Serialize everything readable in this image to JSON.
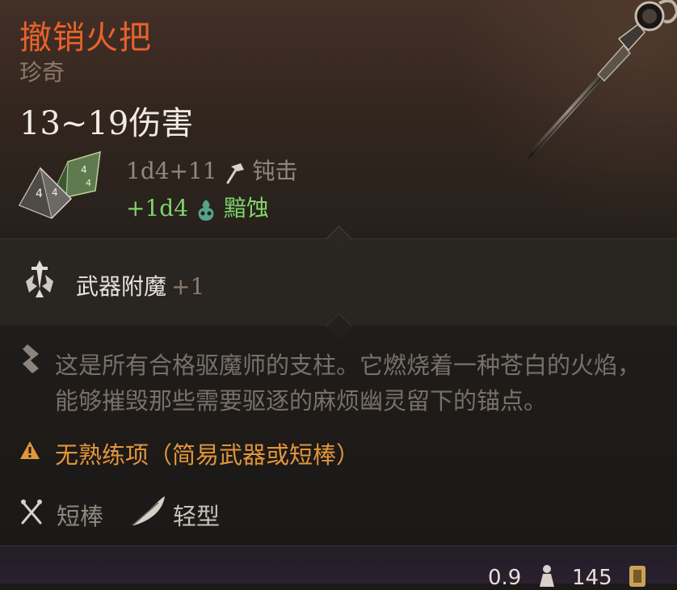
{
  "item": {
    "name": "撤销火把",
    "rarity": "珍奇",
    "damage_range": "13~19伤害",
    "damage_lines": [
      {
        "dice": "1d4+11",
        "type": "钝击",
        "icon": "hammer-icon",
        "color": "#8f8880"
      },
      {
        "dice": "+1d4",
        "type": "黯蚀",
        "icon": "necrotic-skull-icon",
        "color": "#7fd46a"
      }
    ],
    "enchantment": {
      "label": "武器附魔",
      "bonus": "+1",
      "icon": "enchant-sword-icon"
    },
    "description": "这是所有合格驱魔师的支柱。它燃烧着一种苍白的火焰，能够摧毁那些需要驱逐的麻烦幽灵留下的锚点。",
    "warning": "无熟练项（简易武器或短棒）",
    "properties": [
      {
        "label": "短棒",
        "icon": "crossed-clubs-icon"
      },
      {
        "label": "轻型",
        "icon": "feather-icon"
      }
    ],
    "weight": "0.9",
    "price": "145"
  },
  "colors": {
    "name": "#e8622a",
    "rarity": "#8d7a6c",
    "warning": "#e2953a",
    "necrotic": "#7fd46a"
  }
}
